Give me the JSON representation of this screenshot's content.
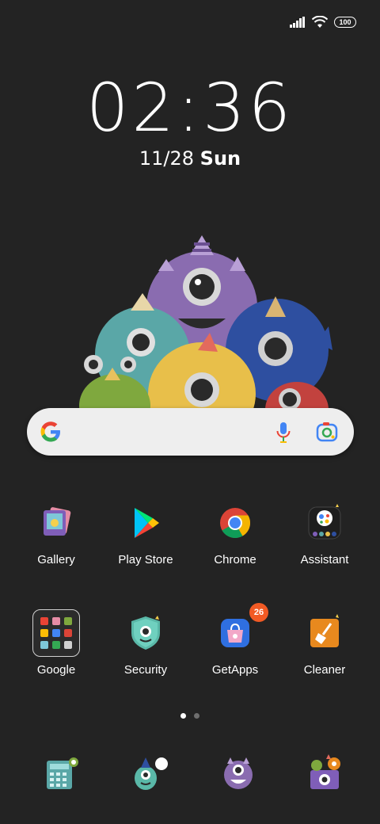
{
  "status": {
    "battery": "100"
  },
  "clock": {
    "time": "02:36",
    "date": "11/28",
    "weekday": "Sun"
  },
  "apps_row1": [
    {
      "label": "Gallery"
    },
    {
      "label": "Play Store"
    },
    {
      "label": "Chrome"
    },
    {
      "label": "Assistant"
    }
  ],
  "apps_row2": [
    {
      "label": "Google"
    },
    {
      "label": "Security"
    },
    {
      "label": "GetApps",
      "badge": "26"
    },
    {
      "label": "Cleaner"
    }
  ],
  "icons": {
    "dock": [
      "calculator-monster-icon",
      "themes-monster-icon",
      "camera-monster-icon",
      "music-monster-icon"
    ]
  },
  "colors": {
    "accent_badge": "#f15a24",
    "background": "#232323"
  }
}
